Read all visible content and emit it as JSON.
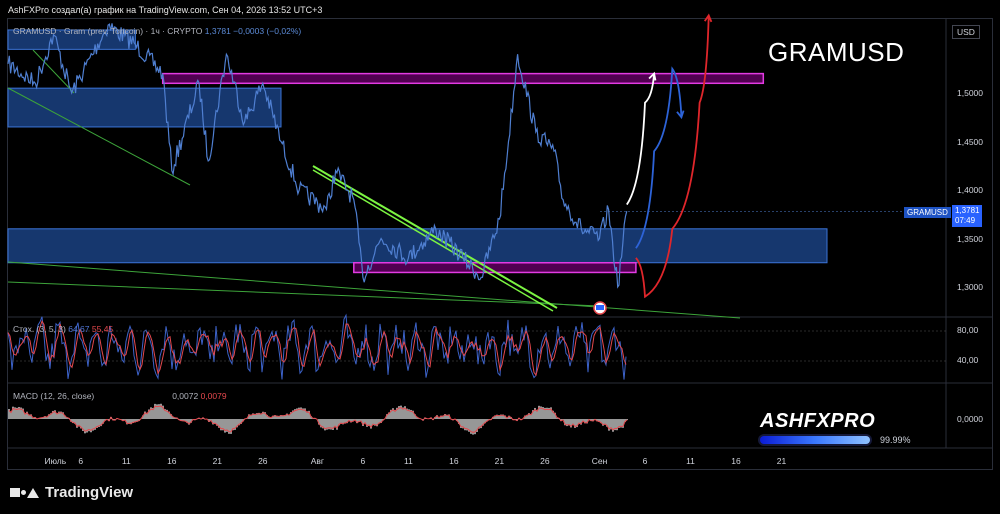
{
  "header_text": "AshFXPro создал(а) график на TradingView.com, Сен 04, 2026 13:52 UTC+3",
  "legend": {
    "symbol": "GRAMUSD · Gram (prev. Toncoin) · 1ч · CRYPTO",
    "values": "1,3781 −0,0003 (−0,02%)"
  },
  "watermark_title": "GRAMUSD",
  "brand": {
    "name": "ASHFXPRO",
    "percent": "99.99%",
    "progress": 0.9999
  },
  "currency": "USD",
  "price_tag": {
    "symbol": "GRAMUSD",
    "price": "1,3781",
    "countdown": "07:49"
  },
  "footer_brand": "TradingView",
  "stoch_label": {
    "name": "Стох. (3, 5, 3)",
    "k": "64,67",
    "d": "55,45"
  },
  "macd_label": {
    "name": "MACD (12, 26, close)",
    "v1": "0,0072",
    "v2": "0,0079"
  },
  "colors": {
    "price_line": "#4f7fd1",
    "zone_blue": "#1f4f9c",
    "zone_magenta": "#b300b3",
    "trend_green": "#7cf542",
    "projection_white": "#ffffff",
    "projection_blue": "#2d63d8",
    "projection_red": "#e0262b",
    "stoch_k": "#3c62c9",
    "stoch_d": "#e5484d",
    "macd_hist": "#c9c9c9",
    "macd_line": "#e5484d"
  },
  "chart_data": [
    {
      "type": "line",
      "title": "GRAMUSD · Gram (prev. Toncoin) · 1ч · CRYPTO",
      "y_axis": {
        "ticks": [
          "1,5000",
          "1,4500",
          "1,4000",
          "1,3500",
          "1,3000"
        ],
        "values": [
          1.5,
          1.45,
          1.4,
          1.35,
          1.3
        ]
      },
      "x_axis": {
        "ticks": [
          "Июль",
          "6",
          "11",
          "16",
          "21",
          "26",
          "Авг",
          "6",
          "11",
          "16",
          "21",
          "26",
          "Сен",
          "6",
          "11",
          "16",
          "21"
        ]
      },
      "last_price": 1.3781,
      "price_keypoints": [
        {
          "date": "2026-06-28",
          "value": 1.53
        },
        {
          "date": "2026-07-01",
          "value": 1.51
        },
        {
          "date": "2026-07-03",
          "value": 1.56
        },
        {
          "date": "2026-07-05",
          "value": 1.5
        },
        {
          "date": "2026-07-09",
          "value": 1.57
        },
        {
          "date": "2026-07-12",
          "value": 1.55
        },
        {
          "date": "2026-07-15",
          "value": 1.52
        },
        {
          "date": "2026-07-16",
          "value": 1.42
        },
        {
          "date": "2026-07-19",
          "value": 1.51
        },
        {
          "date": "2026-07-20",
          "value": 1.43
        },
        {
          "date": "2026-07-22",
          "value": 1.54
        },
        {
          "date": "2026-07-24",
          "value": 1.47
        },
        {
          "date": "2026-07-26",
          "value": 1.51
        },
        {
          "date": "2026-07-28",
          "value": 1.45
        },
        {
          "date": "2026-07-30",
          "value": 1.4
        },
        {
          "date": "2026-08-02",
          "value": 1.38
        },
        {
          "date": "2026-08-03",
          "value": 1.42
        },
        {
          "date": "2026-08-05",
          "value": 1.39
        },
        {
          "date": "2026-08-06",
          "value": 1.31
        },
        {
          "date": "2026-08-08",
          "value": 1.35
        },
        {
          "date": "2026-08-11",
          "value": 1.33
        },
        {
          "date": "2026-08-14",
          "value": 1.36
        },
        {
          "date": "2026-08-17",
          "value": 1.33
        },
        {
          "date": "2026-08-19",
          "value": 1.31
        },
        {
          "date": "2026-08-21",
          "value": 1.37
        },
        {
          "date": "2026-08-22",
          "value": 1.45
        },
        {
          "date": "2026-08-23",
          "value": 1.54
        },
        {
          "date": "2026-08-25",
          "value": 1.46
        },
        {
          "date": "2026-08-27",
          "value": 1.44
        },
        {
          "date": "2026-08-28",
          "value": 1.39
        },
        {
          "date": "2026-08-30",
          "value": 1.36
        },
        {
          "date": "2026-09-01",
          "value": 1.35
        },
        {
          "date": "2026-09-02",
          "value": 1.38
        },
        {
          "date": "2026-09-03",
          "value": 1.3
        },
        {
          "date": "2026-09-04",
          "value": 1.3781
        }
      ],
      "zones": [
        {
          "kind": "blue",
          "from": "2026-06-28",
          "to": "2026-07-12",
          "low": 1.545,
          "high": 1.565
        },
        {
          "kind": "blue",
          "from": "2026-06-28",
          "to": "2026-07-28",
          "low": 1.465,
          "high": 1.505
        },
        {
          "kind": "blue",
          "from": "2026-06-28",
          "to": "2026-09-26",
          "low": 1.325,
          "high": 1.36
        },
        {
          "kind": "magenta",
          "from": "2026-07-15",
          "to": "2026-09-19",
          "low": 1.51,
          "high": 1.52
        },
        {
          "kind": "magenta",
          "from": "2026-08-05",
          "to": "2026-09-05",
          "low": 1.315,
          "high": 1.325
        }
      ],
      "projections": [
        {
          "name": "white",
          "points": [
            {
              "date": "2026-09-04",
              "value": 1.385
            },
            {
              "date": "2026-09-06",
              "value": 1.49
            },
            {
              "date": "2026-09-07",
              "value": 1.52
            }
          ]
        },
        {
          "name": "blue",
          "points": [
            {
              "date": "2026-09-05",
              "value": 1.34
            },
            {
              "date": "2026-09-07",
              "value": 1.44
            },
            {
              "date": "2026-09-09",
              "value": 1.525
            },
            {
              "date": "2026-09-10",
              "value": 1.475
            }
          ]
        },
        {
          "name": "red",
          "points": [
            {
              "date": "2026-09-05",
              "value": 1.33
            },
            {
              "date": "2026-09-06",
              "value": 1.29
            },
            {
              "date": "2026-09-09",
              "value": 1.36
            },
            {
              "date": "2026-09-12",
              "value": 1.49
            },
            {
              "date": "2026-09-13",
              "value": 1.58
            }
          ]
        }
      ]
    },
    {
      "type": "line",
      "title": "Стох. (3, 5, 3)",
      "y_axis": {
        "ticks": [
          "80,00",
          "40,00"
        ],
        "values": [
          80,
          40
        ]
      },
      "series": [
        {
          "name": "K",
          "last": 64.67
        },
        {
          "name": "D",
          "last": 55.45
        }
      ]
    },
    {
      "type": "bar",
      "title": "MACD (12, 26, close)",
      "y_axis": {
        "ticks": [
          "0,0000"
        ],
        "values": [
          0
        ]
      },
      "values_label": [
        "0,0072",
        "0,0079"
      ]
    }
  ]
}
